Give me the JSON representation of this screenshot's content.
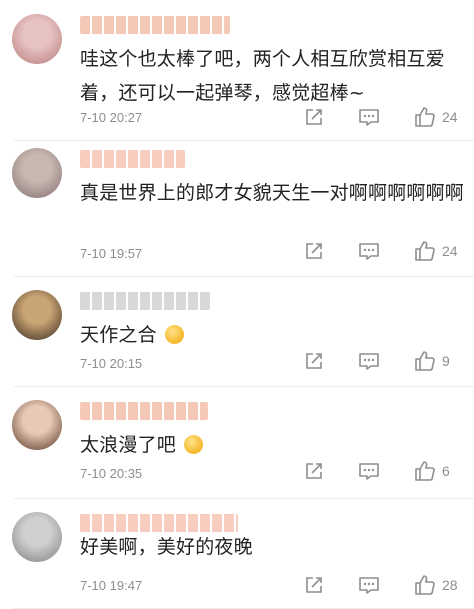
{
  "comments": [
    {
      "text": "哇这个也太棒了吧，两个人相互欣赏相互爱着，还可以一起弹琴，感觉超棒~",
      "time": "7-10 20:27",
      "likes": "24",
      "username_color": "#f6c8b8",
      "avatar_colors": [
        "#e7c3c3",
        "#c08585"
      ]
    },
    {
      "text": "真是世界上的郎才女貌天生一对啊啊啊啊啊啊",
      "time": "7-10 19:57",
      "likes": "24",
      "username_color": "#f8ccbf",
      "avatar_colors": [
        "#c9b7b2",
        "#8d7b78"
      ]
    },
    {
      "text": "天作之合",
      "emoji": "flushed-emoji",
      "time": "7-10 20:15",
      "likes": "9",
      "username_color": "#d8d8d8",
      "avatar_colors": [
        "#c9a474",
        "#4b3a2b"
      ]
    },
    {
      "text": "太浪漫了吧",
      "emoji": "crying-emoji",
      "time": "7-10 20:35",
      "likes": "6",
      "username_color": "#f6c8b8",
      "avatar_colors": [
        "#e8c9b5",
        "#6a4a3b"
      ]
    },
    {
      "text": "好美啊，美好的夜晚",
      "time": "7-10 19:47",
      "likes": "28",
      "username_color": "#f8ccbf",
      "avatar_colors": [
        "#d0d0d0",
        "#8a8a8a"
      ]
    }
  ],
  "icons": {
    "share": "share-icon",
    "comment": "comment-icon",
    "like": "thumbs-up-icon"
  }
}
